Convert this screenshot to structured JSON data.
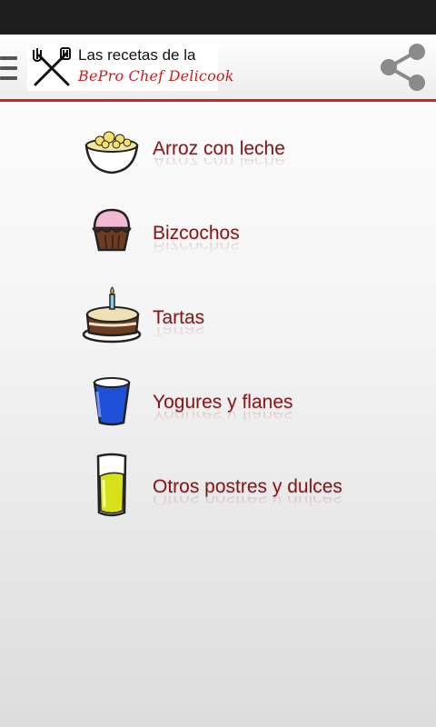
{
  "header": {
    "logo_line1": "Las recetas de la",
    "logo_line2": "BePro Chef Delicook"
  },
  "menu": [
    {
      "label": "Arroz con leche",
      "icon": "rice-pudding-bowl-icon"
    },
    {
      "label": "Bizcochos",
      "icon": "cupcake-icon"
    },
    {
      "label": "Tartas",
      "icon": "birthday-cake-icon"
    },
    {
      "label": "Yogures y flanes",
      "icon": "blue-cup-icon"
    },
    {
      "label": "Otros postres y dulces",
      "icon": "glass-icon"
    }
  ],
  "colors": {
    "accent": "#d41f1f",
    "item_text": "#8a1717",
    "status_bar": "#1e1e1e"
  }
}
